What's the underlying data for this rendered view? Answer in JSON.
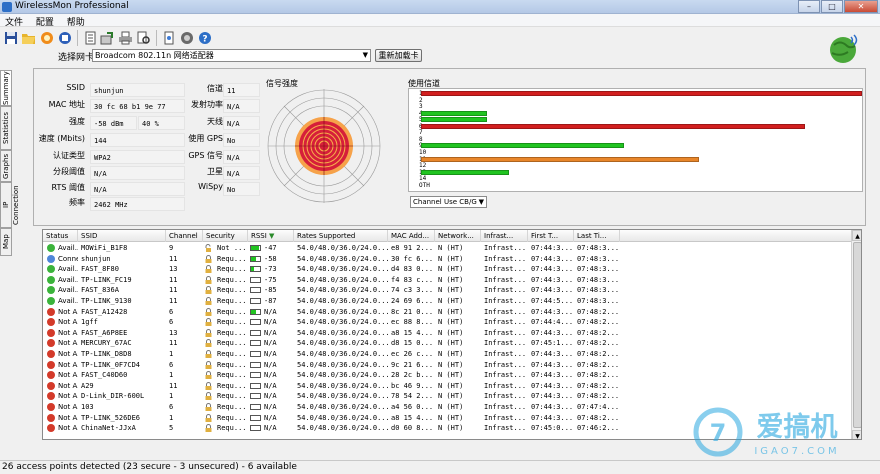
{
  "window": {
    "title": "WirelessMon Professional"
  },
  "menu": [
    "文件",
    "配置",
    "帮助"
  ],
  "toolbar_icons": [
    "save-icon",
    "open-folder-icon",
    "record-icon",
    "stop-icon",
    "log-icon",
    "export-icon",
    "print-icon",
    "print-preview-icon",
    "settings-icon",
    "gps-icon",
    "help-icon"
  ],
  "nic": {
    "label": "选择网卡",
    "selected": "Broadcom 802.11n 网络适配器",
    "reload_label": "重新加载卡"
  },
  "side_tabs": [
    "Summary",
    "Statistics",
    "Graphs",
    "IP Connection",
    "Map"
  ],
  "info_left": [
    {
      "label": "SSID",
      "value": "shunjun"
    },
    {
      "label": "MAC 地址",
      "value": "30 fc 68 b1 9e 77"
    },
    {
      "label": "强度",
      "value": "-58 dBm",
      "value2": "40 %"
    },
    {
      "label": "速度 (Mbits)",
      "value": "144"
    },
    {
      "label": "认证类型",
      "value": "WPA2"
    },
    {
      "label": "分段阈值",
      "value": "N/A"
    },
    {
      "label": "RTS 阈值",
      "value": "N/A"
    },
    {
      "label": "频率",
      "value": "2462 MHz"
    }
  ],
  "info_right": [
    {
      "label": "信道",
      "value": "11"
    },
    {
      "label": "发射功率",
      "value": "N/A"
    },
    {
      "label": "天线",
      "value": "N/A"
    },
    {
      "label": "使用 GPS",
      "value": "No"
    },
    {
      "label": "GPS 信号",
      "value": "N/A"
    },
    {
      "label": "卫星",
      "value": "N/A"
    },
    {
      "label": "WiSpy",
      "value": "No"
    }
  ],
  "signal": {
    "title": "信号强度"
  },
  "channels": {
    "title": "使用信道",
    "labels": [
      "1",
      "2",
      "3",
      "4",
      "5",
      "6",
      "7",
      "8",
      "9",
      "10",
      "11",
      "12",
      "13",
      "14",
      "OTH"
    ],
    "usage": [
      {
        "channel": "1",
        "fraction": 1.0,
        "color": "#d21f1f"
      },
      {
        "channel": "4",
        "fraction": 0.15,
        "color": "#21c421"
      },
      {
        "channel": "5",
        "fraction": 0.15,
        "color": "#21c421"
      },
      {
        "channel": "6",
        "fraction": 0.87,
        "color": "#d21f1f"
      },
      {
        "channel": "9",
        "fraction": 0.46,
        "color": "#21c421"
      },
      {
        "channel": "11",
        "fraction": 0.63,
        "color": "#e8862a"
      },
      {
        "channel": "13",
        "fraction": 0.2,
        "color": "#21c421"
      }
    ],
    "select": "Channel Use CB/G"
  },
  "list": {
    "columns": [
      "Status",
      "SSID",
      "Channel",
      "Security",
      "RSSI",
      "Rates Supported",
      "MAC Add...",
      "Network...",
      "Infrast...",
      "First T...",
      "Last Ti..."
    ],
    "rows": [
      {
        "status": "Avail...",
        "color": "#3bb33b",
        "ssid": "MOWiFi_B1F8",
        "channel": "9",
        "security": "Not ...",
        "open": true,
        "rssi": "-47",
        "bar": 0.9,
        "rates": "54.0/48.0/36.0/24.0...",
        "mac": "e8 91 2...",
        "network": "N (HT)",
        "infra": "Infrast...",
        "first": "07:44:3...",
        "last": "07:48:3..."
      },
      {
        "status": "Conne...",
        "color": "#4f86d9",
        "ssid": "shunjun",
        "channel": "11",
        "security": "Requ...",
        "open": false,
        "rssi": "-58",
        "bar": 0.6,
        "rates": "54.0/48.0/36.0/24.0...",
        "mac": "30 fc 6...",
        "network": "N (HT)",
        "infra": "Infrast...",
        "first": "07:44:3...",
        "last": "07:48:3..."
      },
      {
        "status": "Avail...",
        "color": "#3bb33b",
        "ssid": "FAST_8F80",
        "channel": "13",
        "security": "Requ...",
        "open": false,
        "rssi": "-73",
        "bar": 0.3,
        "rates": "54.0/48.0/36.0/24.0...",
        "mac": "d4 83 0...",
        "network": "N (HT)",
        "infra": "Infrast...",
        "first": "07:44:3...",
        "last": "07:48:3..."
      },
      {
        "status": "Avail...",
        "color": "#3bb33b",
        "ssid": "TP-LINK_FC19",
        "channel": "11",
        "security": "Requ...",
        "open": false,
        "rssi": "-75",
        "bar": 0.0,
        "rates": "54.0/48.0/36.0/24.0...",
        "mac": "f4 83 c...",
        "network": "N (HT)",
        "infra": "Infrast...",
        "first": "07:44:3...",
        "last": "07:48:3..."
      },
      {
        "status": "Avail...",
        "color": "#3bb33b",
        "ssid": "FAST_836A",
        "channel": "11",
        "security": "Requ...",
        "open": false,
        "rssi": "-85",
        "bar": 0.0,
        "rates": "54.0/48.0/36.0/24.0...",
        "mac": "74 c3 3...",
        "network": "N (HT)",
        "infra": "Infrast...",
        "first": "07:44:3...",
        "last": "07:48:3..."
      },
      {
        "status": "Avail...",
        "color": "#3bb33b",
        "ssid": "TP-LINK_9130",
        "channel": "11",
        "security": "Requ...",
        "open": false,
        "rssi": "-87",
        "bar": 0.0,
        "rates": "54.0/48.0/36.0/24.0...",
        "mac": "24 69 6...",
        "network": "N (HT)",
        "infra": "Infrast...",
        "first": "07:44:5...",
        "last": "07:48:3..."
      },
      {
        "status": "Not A...",
        "color": "#d33a2a",
        "ssid": "FAST_A12428",
        "channel": "6",
        "security": "Requ...",
        "open": false,
        "rssi": "N/A",
        "bar": 0.6,
        "rates": "54.0/48.0/36.0/24.0...",
        "mac": "8c 21 0...",
        "network": "N (HT)",
        "infra": "Infrast...",
        "first": "07:44:3...",
        "last": "07:48:2..."
      },
      {
        "status": "Not A...",
        "color": "#d33a2a",
        "ssid": "1gff",
        "channel": "6",
        "security": "Requ...",
        "open": false,
        "rssi": "N/A",
        "bar": 0.0,
        "rates": "54.0/48.0/36.0/24.0...",
        "mac": "ec 88 8...",
        "network": "N (HT)",
        "infra": "Infrast...",
        "first": "07:44:4...",
        "last": "07:48:2..."
      },
      {
        "status": "Not A...",
        "color": "#d33a2a",
        "ssid": "FAST_A6P8EE",
        "channel": "13",
        "security": "Requ...",
        "open": false,
        "rssi": "N/A",
        "bar": 0.0,
        "rates": "54.0/48.0/36.0/24.0...",
        "mac": "a8 15 4...",
        "network": "N (HT)",
        "infra": "Infrast...",
        "first": "07:44:3...",
        "last": "07:48:2..."
      },
      {
        "status": "Not A...",
        "color": "#d33a2a",
        "ssid": "MERCURY_67AC",
        "channel": "11",
        "security": "Requ...",
        "open": false,
        "rssi": "N/A",
        "bar": 0.0,
        "rates": "54.0/48.0/36.0/24.0...",
        "mac": "d8 15 0...",
        "network": "N (HT)",
        "infra": "Infrast...",
        "first": "07:45:1...",
        "last": "07:48:2..."
      },
      {
        "status": "Not A...",
        "color": "#d33a2a",
        "ssid": "TP-LINK_D8D8",
        "channel": "1",
        "security": "Requ...",
        "open": false,
        "rssi": "N/A",
        "bar": 0.0,
        "rates": "54.0/48.0/36.0/24.0...",
        "mac": "ec 26 c...",
        "network": "N (HT)",
        "infra": "Infrast...",
        "first": "07:44:3...",
        "last": "07:48:2..."
      },
      {
        "status": "Not A...",
        "color": "#d33a2a",
        "ssid": "TP-LINK_0F7CD4",
        "channel": "6",
        "security": "Requ...",
        "open": false,
        "rssi": "N/A",
        "bar": 0.0,
        "rates": "54.0/48.0/36.0/24.0...",
        "mac": "9c 21 6...",
        "network": "N (HT)",
        "infra": "Infrast...",
        "first": "07:44:3...",
        "last": "07:48:2..."
      },
      {
        "status": "Not A...",
        "color": "#d33a2a",
        "ssid": "FAST_C40D60",
        "channel": "1",
        "security": "Requ...",
        "open": false,
        "rssi": "N/A",
        "bar": 0.0,
        "rates": "54.0/48.0/36.0/24.0...",
        "mac": "28 2c b...",
        "network": "N (HT)",
        "infra": "Infrast...",
        "first": "07:44:3...",
        "last": "07:48:2..."
      },
      {
        "status": "Not A...",
        "color": "#d33a2a",
        "ssid": "A29",
        "channel": "11",
        "security": "Requ...",
        "open": false,
        "rssi": "N/A",
        "bar": 0.0,
        "rates": "54.0/48.0/36.0/24.0...",
        "mac": "bc 46 9...",
        "network": "N (HT)",
        "infra": "Infrast...",
        "first": "07:44:3...",
        "last": "07:48:2..."
      },
      {
        "status": "Not A...",
        "color": "#d33a2a",
        "ssid": "D-Link_DIR-600L",
        "channel": "1",
        "security": "Requ...",
        "open": false,
        "rssi": "N/A",
        "bar": 0.0,
        "rates": "54.0/48.0/36.0/24.0...",
        "mac": "78 54 2...",
        "network": "N (HT)",
        "infra": "Infrast...",
        "first": "07:44:3...",
        "last": "07:48:2..."
      },
      {
        "status": "Not A...",
        "color": "#d33a2a",
        "ssid": "103",
        "channel": "6",
        "security": "Requ...",
        "open": false,
        "rssi": "N/A",
        "bar": 0.0,
        "rates": "54.0/48.0/36.0/24.0...",
        "mac": "a4 56 0...",
        "network": "N (HT)",
        "infra": "Infrast...",
        "first": "07:44:3...",
        "last": "07:47:4..."
      },
      {
        "status": "Not A...",
        "color": "#d33a2a",
        "ssid": "TP-LINK_526DE6",
        "channel": "1",
        "security": "Requ...",
        "open": false,
        "rssi": "N/A",
        "bar": 0.0,
        "rates": "54.0/48.0/36.0/24.0...",
        "mac": "a8 15 4...",
        "network": "N (HT)",
        "infra": "Infrast...",
        "first": "07:44:3...",
        "last": "07:48:2..."
      },
      {
        "status": "Not A...",
        "color": "#d33a2a",
        "ssid": "ChinaNet-JJxA",
        "channel": "5",
        "security": "Requ...",
        "open": false,
        "rssi": "N/A",
        "bar": 0.0,
        "rates": "54.0/48.0/36.0/24.0...",
        "mac": "d0 60 8...",
        "network": "N (HT)",
        "infra": "Infrast...",
        "first": "07:45:0...",
        "last": "07:46:2..."
      }
    ]
  },
  "statusbar": "26 access points detected (23 secure - 3 unsecured) - 6 available",
  "watermark": {
    "brand": "爱搞机",
    "url": "IGAO7.COM"
  }
}
